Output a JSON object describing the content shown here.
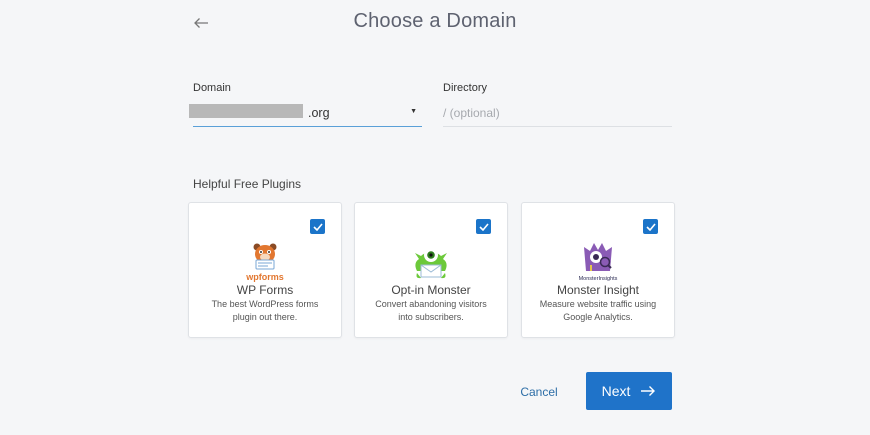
{
  "header": {
    "title": "Choose a Domain",
    "back_icon": "arrow-left-icon"
  },
  "form": {
    "domain": {
      "label": "Domain",
      "value": ".org",
      "icon": "caret-down-icon"
    },
    "directory": {
      "label": "Directory",
      "placeholder": "/ (optional)"
    }
  },
  "plugins": {
    "heading": "Helpful Free Plugins",
    "items": [
      {
        "name": "WP Forms",
        "description": "The best WordPress forms plugin out there.",
        "logo_text": "wpforms",
        "checked": true
      },
      {
        "name": "Opt-in Monster",
        "description": "Convert abandoning visitors into subscribers.",
        "checked": true
      },
      {
        "name": "Monster Insight",
        "description": "Measure website traffic using Google Analytics.",
        "logo_text": "MonsterInsights",
        "checked": true
      }
    ]
  },
  "actions": {
    "cancel_label": "Cancel",
    "next_label": "Next",
    "next_icon": "arrow-right-icon"
  },
  "colors": {
    "accent": "#1f73c9",
    "link": "#2d6ea7",
    "background": "#f5f6f8"
  }
}
